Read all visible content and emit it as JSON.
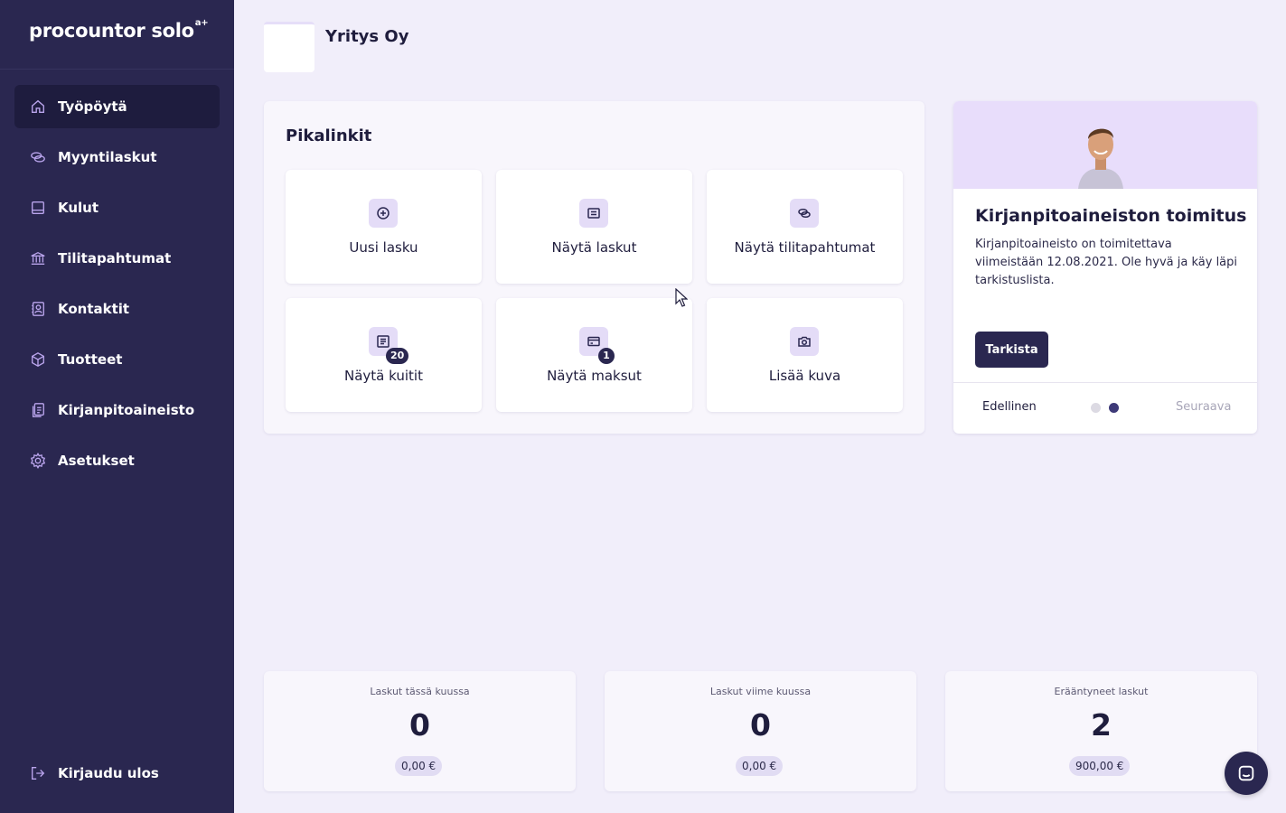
{
  "app": {
    "logo": "procountor solo",
    "logo_sup": "a+"
  },
  "sidebar": {
    "items": [
      {
        "label": "Työpöytä",
        "icon": "home-icon",
        "active": true
      },
      {
        "label": "Myyntilaskut",
        "icon": "coins-icon"
      },
      {
        "label": "Kulut",
        "icon": "inbox-icon"
      },
      {
        "label": "Tilitapahtumat",
        "icon": "bank-icon"
      },
      {
        "label": "Kontaktit",
        "icon": "contact-icon"
      },
      {
        "label": "Tuotteet",
        "icon": "box-icon"
      },
      {
        "label": "Kirjanpitoaineisto",
        "icon": "documents-icon"
      },
      {
        "label": "Asetukset",
        "icon": "gear-icon"
      }
    ],
    "logout": {
      "label": "Kirjaudu ulos",
      "icon": "logout-icon"
    }
  },
  "header": {
    "company_name": "Yritys Oy"
  },
  "quick_links": {
    "title": "Pikalinkit",
    "tiles": [
      {
        "label": "Uusi lasku",
        "icon": "plus-circle-icon"
      },
      {
        "label": "Näytä laskut",
        "icon": "invoice-icon"
      },
      {
        "label": "Näytä tilitapahtumat",
        "icon": "coins-icon"
      },
      {
        "label": "Näytä kuitit",
        "icon": "receipt-icon",
        "badge": "20"
      },
      {
        "label": "Näytä maksut",
        "icon": "card-icon",
        "badge": "1"
      },
      {
        "label": "Lisää kuva",
        "icon": "camera-icon"
      }
    ]
  },
  "promo": {
    "title": "Kirjanpitoaineiston toimitus",
    "text": "Kirjanpitoaineisto on toimitettava viimeistään 12.08.2021. Ole hyvä ja käy läpi tarkistuslista.",
    "button": "Tarkista",
    "prev": "Edellinen",
    "next": "Seuraava",
    "dots_total": 2,
    "dots_active": 2
  },
  "stats": [
    {
      "label": "Laskut tässä kuussa",
      "value": "0",
      "amount": "0,00 €"
    },
    {
      "label": "Laskut viime kuussa",
      "value": "0",
      "amount": "0,00 €"
    },
    {
      "label": "Erääntyneet laskut",
      "value": "2",
      "amount": "900,00 €"
    }
  ],
  "colors": {
    "sidebar": "#2a2750",
    "accent": "#b9a4ec",
    "background": "#f1eefa"
  }
}
